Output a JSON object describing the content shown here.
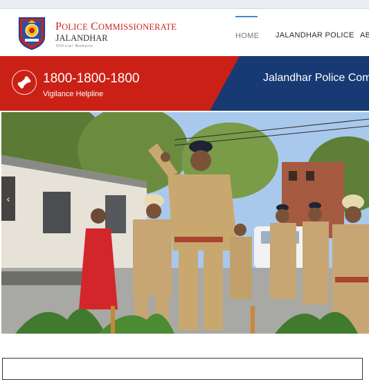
{
  "header": {
    "title": "Police Commissionerate",
    "title_first": "P",
    "title_rest_1": "OLICE",
    "title_c": "C",
    "title_rest_2": "OMMISSIONERATE",
    "city_first": "J",
    "city_rest": "ALANDHAR",
    "subtitle": "Official Website",
    "logo_alt": "Punjab Police logo"
  },
  "nav": {
    "items": [
      {
        "label": "HOME",
        "active": true
      },
      {
        "label": "JALANDHAR POLICE",
        "active": false
      },
      {
        "label": "AB",
        "active": false
      }
    ]
  },
  "banner": {
    "phone": "1800-1800-1800",
    "phone_label": "Vigilance Helpline",
    "marquee": "Jalandhar Police Com",
    "icon": "phone-icon",
    "colors": {
      "red": "#cb2016",
      "blue": "#173a74"
    }
  },
  "slider": {
    "prev_icon": "chevron-left-icon",
    "prev_glyph": "‹",
    "image_alt": "Police officers saluting at ceremony"
  }
}
